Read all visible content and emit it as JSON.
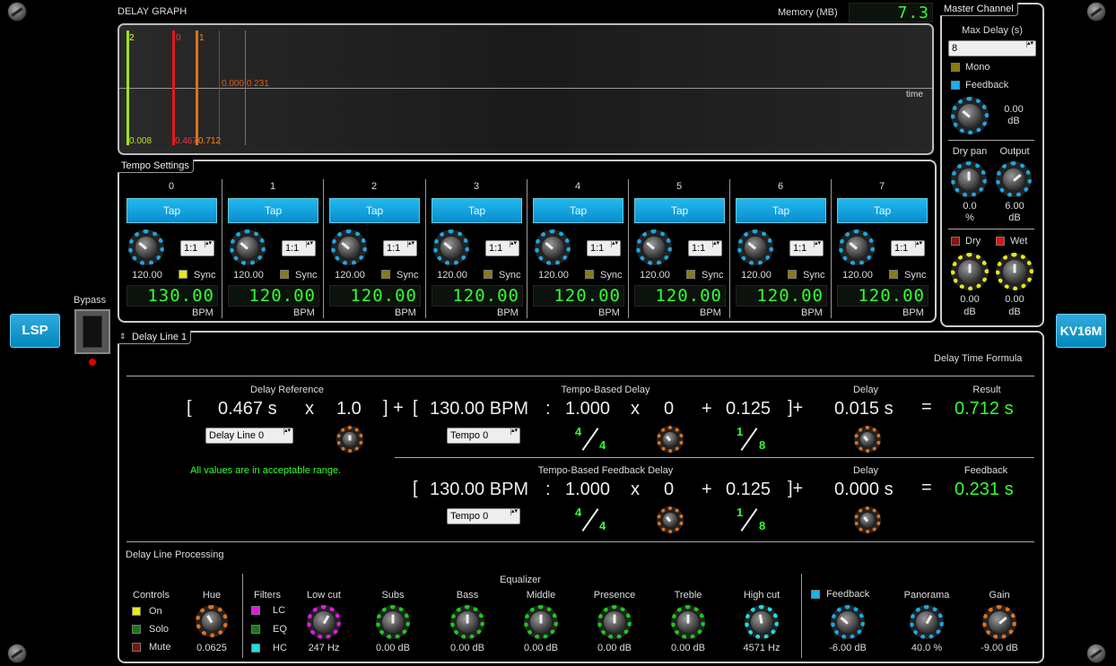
{
  "graph": {
    "title": "DELAY GRAPH",
    "memory_label": "Memory (MB)",
    "memory_value": "7.3",
    "axis_label": "time",
    "markers": [
      "2",
      "0",
      "1"
    ],
    "top_values": "0.000 0.231",
    "bottom_values": [
      "0.008",
      "0.467",
      "0.712"
    ]
  },
  "tempo": {
    "title": "Tempo Settings",
    "tap_label": "Tap",
    "ratio": "1:1",
    "sync_label": "Sync",
    "bpm_unit": "BPM",
    "channels": [
      {
        "n": "0",
        "knob_value": "120.00",
        "lcd": "130.00"
      },
      {
        "n": "1",
        "knob_value": "120.00",
        "lcd": "120.00"
      },
      {
        "n": "2",
        "knob_value": "120.00",
        "lcd": "120.00"
      },
      {
        "n": "3",
        "knob_value": "120.00",
        "lcd": "120.00"
      },
      {
        "n": "4",
        "knob_value": "120.00",
        "lcd": "120.00"
      },
      {
        "n": "5",
        "knob_value": "120.00",
        "lcd": "120.00"
      },
      {
        "n": "6",
        "knob_value": "120.00",
        "lcd": "120.00"
      },
      {
        "n": "7",
        "knob_value": "120.00",
        "lcd": "120.00"
      }
    ]
  },
  "master": {
    "title": "Master Channel",
    "max_delay_label": "Max Delay (s)",
    "max_delay_value": "8",
    "mono_label": "Mono",
    "feedback_label": "Feedback",
    "feedback_value": "0.00",
    "feedback_unit": "dB",
    "drypan_label": "Dry pan",
    "drypan_value": "0.0",
    "drypan_unit": "%",
    "output_label": "Output",
    "output_value": "6.00",
    "output_unit": "dB",
    "dry_label": "Dry",
    "dry_value": "0.00",
    "dry_unit": "dB",
    "wet_label": "Wet",
    "wet_value": "0.00",
    "wet_unit": "dB"
  },
  "side": {
    "bypass_label": "Bypass",
    "lsp": "LSP",
    "kv": "KV16M"
  },
  "delay_line": {
    "selector": "Delay Line 1",
    "formula_title": "Delay Time Formula",
    "delay_ref_label": "Delay Reference",
    "delay_ref_value": "0.467 s",
    "mult": "1.0",
    "ref_select": "Delay Line 0",
    "tempo_delay_label": "Tempo-Based Delay",
    "bpm": "130.00 BPM",
    "frac": "1.000",
    "x_val": "0",
    "add": "0.125",
    "tempo_select": "Tempo 0",
    "num": "4",
    "den": "4",
    "num2": "1",
    "den2": "8",
    "delay_label": "Delay",
    "delay_value": "0.015 s",
    "result_label": "Result",
    "result_value": "0.712 s",
    "range_msg": "All values are in acceptable range.",
    "fb_label": "Tempo-Based Feedback Delay",
    "fb_bpm": "130.00 BPM",
    "fb_frac": "1.000",
    "fb_x": "0",
    "fb_add": "0.125",
    "fb_delay_value": "0.000 s",
    "feedback_label": "Feedback",
    "feedback_value": "0.231 s",
    "symbols": {
      "open": "[",
      "close": "]",
      "close_plus": "] +",
      "plus": "+",
      "times": "x",
      "colon": ":",
      "eq": "=",
      "close_plus2": "]+"
    }
  },
  "processing": {
    "title": "Delay Line Processing",
    "controls_label": "Controls",
    "on": "On",
    "solo": "Solo",
    "mute": "Mute",
    "hue_label": "Hue",
    "hue_value": "0.0625",
    "filters_label": "Filters",
    "lc": "LC",
    "eq": "EQ",
    "hc": "HC",
    "equalizer_label": "Equalizer",
    "lowcut_label": "Low cut",
    "lowcut_value": "247 Hz",
    "subs_label": "Subs",
    "subs_value": "0.00 dB",
    "bass_label": "Bass",
    "bass_value": "0.00 dB",
    "middle_label": "Middle",
    "middle_value": "0.00 dB",
    "presence_label": "Presence",
    "presence_value": "0.00 dB",
    "treble_label": "Treble",
    "treble_value": "0.00 dB",
    "highcut_label": "High cut",
    "highcut_value": "4571 Hz",
    "feedback_label": "Feedback",
    "feedback_value": "-6.00 dB",
    "panorama_label": "Panorama",
    "panorama_value": "40.0 %",
    "gain_label": "Gain",
    "gain_value": "-9.00 dB"
  },
  "colors": {
    "accent": "#1aa8e0",
    "green": "#33ff33",
    "orange": "#e0701a",
    "yellow": "#e8e81a",
    "magenta": "#e01ae0",
    "cyan": "#1ae0e0",
    "knob_green": "#1ac81a"
  }
}
